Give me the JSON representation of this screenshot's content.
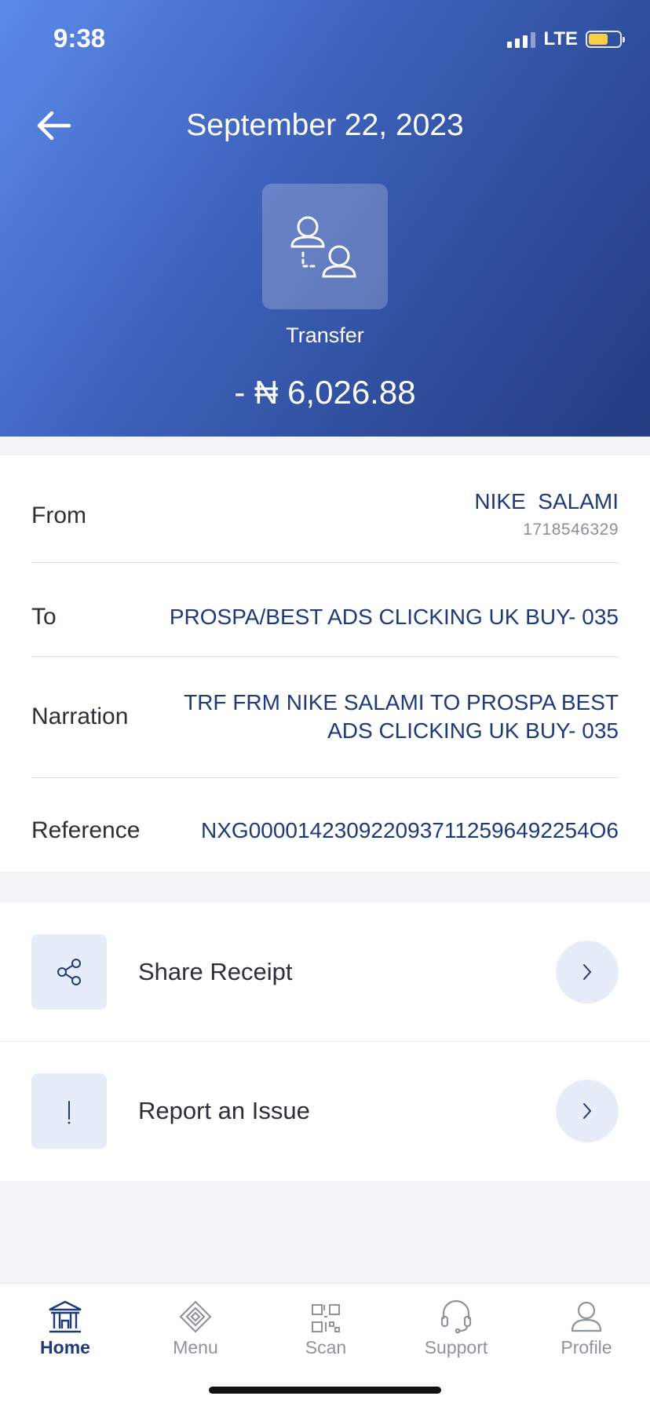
{
  "status_bar": {
    "time": "9:38",
    "network": "LTE"
  },
  "header": {
    "title": "September 22, 2023",
    "transaction_type": "Transfer",
    "amount": "- ₦ 6,026.88"
  },
  "details": {
    "from": {
      "label": "From",
      "name": "NIKE  SALAMI",
      "account": "1718546329"
    },
    "to": {
      "label": "To",
      "value": "PROSPA/BEST ADS CLICKING UK BUY- 035"
    },
    "narration": {
      "label": "Narration",
      "line1": "TRF FRM NIKE SALAMI TO PROSPA BEST",
      "line2": "ADS CLICKING UK BUY- 035"
    },
    "reference": {
      "label": "Reference",
      "value": "NXG0000142309220937112596492254O6"
    }
  },
  "actions": [
    {
      "label": "Share Receipt",
      "icon": "share-icon"
    },
    {
      "label": "Report an Issue",
      "icon": "exclamation-icon"
    }
  ],
  "tabbar": {
    "items": [
      {
        "label": "Home",
        "icon": "bank-icon",
        "active": true
      },
      {
        "label": "Menu",
        "icon": "diamond-icon",
        "active": false
      },
      {
        "label": "Scan",
        "icon": "qr-icon",
        "active": false
      },
      {
        "label": "Support",
        "icon": "headset-icon",
        "active": false
      },
      {
        "label": "Profile",
        "icon": "user-icon",
        "active": false
      }
    ]
  },
  "colors": {
    "accent": "#1f3a7a",
    "header_gradient_start": "#5b8aea",
    "header_gradient_end": "#243d83",
    "chip_bg": "#e7edf8"
  }
}
